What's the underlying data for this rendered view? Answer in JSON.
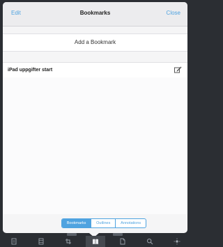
{
  "navbar": {
    "edit_label": "Edit",
    "title": "Bookmarks",
    "close_label": "Close"
  },
  "add_bookmark": {
    "label": "Add a Bookmark"
  },
  "bookmarks": [
    {
      "label": "iPad uppgifter start",
      "icon": "edit-icon"
    }
  ],
  "segmented_control": {
    "items": [
      {
        "label": "Bookmarks",
        "selected": true
      },
      {
        "label": "Outlines",
        "selected": false
      },
      {
        "label": "Annotations",
        "selected": false
      }
    ]
  },
  "toolbar": {
    "items": [
      {
        "icon": "document-icon"
      },
      {
        "icon": "thumbnails-icon"
      },
      {
        "icon": "crop-icon"
      },
      {
        "icon": "book-icon",
        "active": true
      },
      {
        "icon": "page-icon"
      },
      {
        "icon": "search-icon"
      },
      {
        "icon": "brightness-icon"
      }
    ]
  },
  "colors": {
    "accent": "#4fa3e0",
    "toolbar_bg": "#2b2e33",
    "panel_bg": "#f5f5f6"
  }
}
